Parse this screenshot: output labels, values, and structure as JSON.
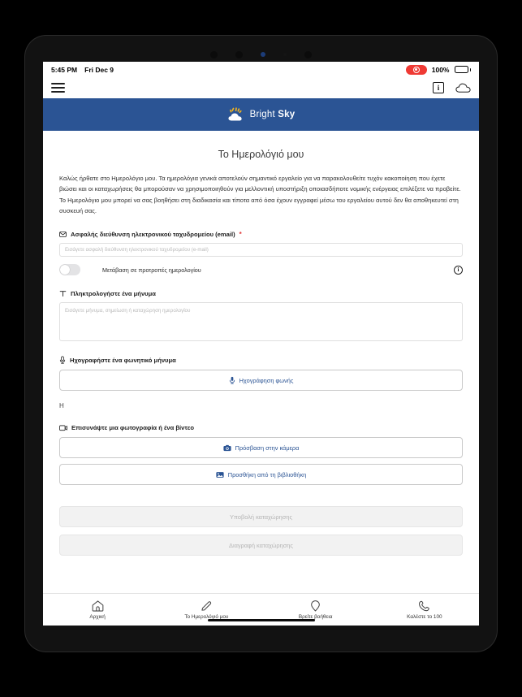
{
  "statusbar": {
    "time": "5:45 PM",
    "date": "Fri Dec 9",
    "battery_percent": "100%",
    "recording_icon": "screen-record-icon",
    "battery_icon": "battery-charging-icon"
  },
  "navbar": {
    "menu_icon": "hamburger-menu-icon",
    "info_icon": "information-icon",
    "cloud_icon": "cloud-icon"
  },
  "brand": {
    "name_light": "Bright ",
    "name_bold": "Sky",
    "logo_icon": "sun-behind-cloud-icon"
  },
  "main": {
    "title": "Το Ημερολόγιό μου",
    "intro": "Καλώς ήρθατε στο Ημερολόγιο μου. Τα ημερολόγια γενικά αποτελούν σημαντικό εργαλείο για να παρακολουθείτε τυχόν κακοποίηση που έχετε βιώσει και οι καταχωρήσεις θα μπορούσαν να χρησιμοποιηθούν για μελλοντική υποστήριξη οποιασδήποτε νομικής ενέργειας επιλέξετε να προβείτε. Το Ημερολόγιο μου μπορεί να σας βοηθήσει στη διαδικασία και τίποτα από όσα έχουν εγγραφεί μέσω του εργαλείου αυτού δεν θα αποθηκευτεί στη συσκευή σας.",
    "email": {
      "label": "Ασφαλής διεύθυνση ηλεκτρονικού ταχυδρομείου (email)",
      "required_mark": "*",
      "icon": "envelope-icon",
      "placeholder": "Εισάγετε ασφαλή διεύθυνση ηλεκτρονικού ταχυδρομείου (e-mail)",
      "value": ""
    },
    "prompts_toggle": {
      "label": "Μετάβαση σε προτροπές ημερολογίου",
      "state": "off",
      "info_icon": "information-circle-icon"
    },
    "message": {
      "label": "Πληκτρολογήστε ένα μήνυμα",
      "icon": "text-format-icon",
      "placeholder": "Εισάγετε μήνυμα, σημείωση ή καταχώρηση ημερολογίου",
      "value": ""
    },
    "voice": {
      "label": "Ηχογραφήστε ένα φωνητικό μήνυμα",
      "icon": "microphone-icon",
      "button_label": "Ηχογράφηση φωνής",
      "button_icon": "microphone-icon"
    },
    "stray_text": "Η",
    "attachment": {
      "label": "Επισυνάψτε μια φωτογραφία ή ένα βίντεο",
      "icon": "photo-video-icon",
      "camera_button_label": "Πρόσβαση στην κάμερα",
      "camera_button_icon": "camera-icon",
      "library_button_label": "Προσθήκη από τη βιβλιοθήκη",
      "library_button_icon": "image-icon"
    },
    "submit_button_label": "Υποβολή καταχώρησης",
    "delete_button_label": "Διαγραφή καταχώρησης"
  },
  "tabbar": {
    "items": [
      {
        "label": "Αρχική",
        "icon": "home-icon"
      },
      {
        "label": "Το Ημερολόγιό μου",
        "icon": "pencil-icon"
      },
      {
        "label": "Βρείτε βοήθεια",
        "icon": "location-pin-icon"
      },
      {
        "label": "Καλέστε το 100",
        "icon": "phone-icon"
      }
    ]
  },
  "colors": {
    "brand_blue": "#2b5494",
    "accent_link": "#2b5494",
    "required_red": "#e03b3b",
    "battery_green": "#35c759",
    "record_red": "#ef3a34"
  }
}
